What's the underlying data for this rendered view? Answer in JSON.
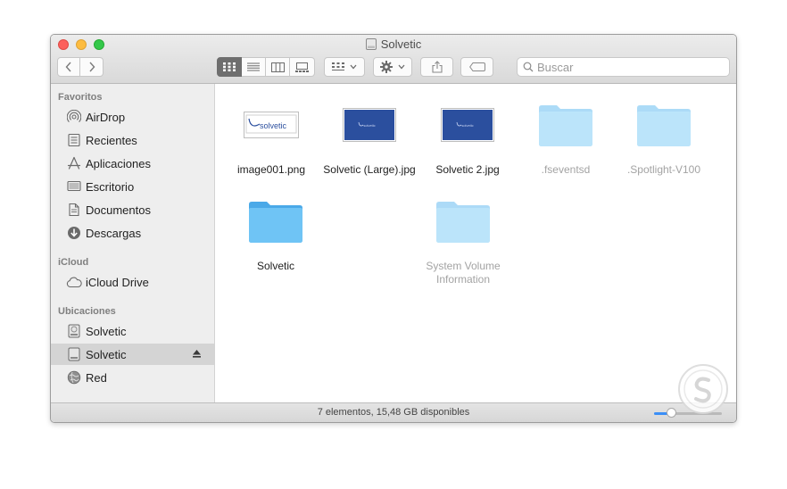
{
  "window": {
    "title": "Solvetic"
  },
  "toolbar": {
    "view_modes": [
      "icons-view",
      "list-view",
      "columns-view",
      "gallery-view"
    ],
    "active_view": "icons-view"
  },
  "search": {
    "placeholder": "Buscar",
    "value": ""
  },
  "sidebar": {
    "sections": [
      {
        "title": "Favoritos",
        "items": [
          {
            "label": "AirDrop",
            "icon": "airdrop-icon"
          },
          {
            "label": "Recientes",
            "icon": "recents-icon"
          },
          {
            "label": "Aplicaciones",
            "icon": "applications-icon"
          },
          {
            "label": "Escritorio",
            "icon": "desktop-icon"
          },
          {
            "label": "Documentos",
            "icon": "documents-icon"
          },
          {
            "label": "Descargas",
            "icon": "downloads-icon"
          }
        ]
      },
      {
        "title": "iCloud",
        "items": [
          {
            "label": "iCloud Drive",
            "icon": "cloud-icon"
          }
        ]
      },
      {
        "title": "Ubicaciones",
        "items": [
          {
            "label": "Solvetic",
            "icon": "hard-drive-icon"
          },
          {
            "label": "Solvetic",
            "icon": "external-drive-icon",
            "selected": true,
            "eject": true
          },
          {
            "label": "Red",
            "icon": "network-icon"
          }
        ]
      }
    ]
  },
  "files": [
    {
      "name": "image001.png",
      "type": "image-logo"
    },
    {
      "name": "Solvetic (Large).jpg",
      "type": "image-blue"
    },
    {
      "name": "Solvetic 2.jpg",
      "type": "image-blue"
    },
    {
      "name": ".fseventsd",
      "type": "folder",
      "hidden": true
    },
    {
      "name": ".Spotlight-V100",
      "type": "folder",
      "hidden": true
    },
    {
      "name": "Solvetic",
      "type": "folder",
      "hidden": false
    },
    {
      "name": "System Volume Information",
      "type": "folder",
      "hidden": true
    }
  ],
  "logo_text": "solvetic",
  "status": {
    "text": "7 elementos, 15,48 GB disponibles",
    "zoom_level": 0.25
  },
  "colors": {
    "folder": "#6fc4f5",
    "image_blue": "#2b4f9e",
    "selection": "#d4d4d4"
  }
}
